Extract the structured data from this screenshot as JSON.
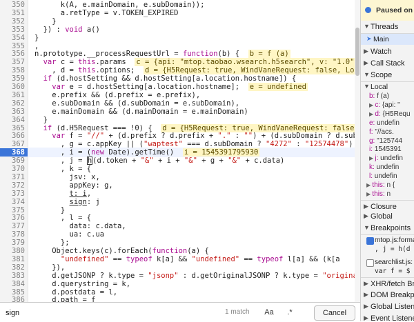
{
  "editor": {
    "lines": [
      {
        "n": "350",
        "html": "<span>k(A, e.mainDomain, e.subDomain));</span>"
      },
      {
        "n": "351",
        "html": "<span>a.retType = v.TOKEN_EXPIRED</span>"
      },
      {
        "n": "352",
        "html": "}"
      },
      {
        "n": "353",
        "html": "}) : <span class=\"kw\">void</span> a()"
      },
      {
        "n": "354",
        "html": "}"
      },
      {
        "n": "355",
        "html": ","
      },
      {
        "n": "356",
        "html": "n.prototype.__processRequestUrl = <span class=\"kw\">function</span>(b) {  <span class=\"inl\">b = f (a)</span>"
      },
      {
        "n": "357",
        "html": "<span class=\"kw\">var</span> c = <span class=\"kw\">this</span>.params  <span class=\"inl\">c = {api: \"mtop.taobao.wsearch.h5search\", v: \"1.0\", </span>"
      },
      {
        "n": "358",
        "html": "  , d = <span class=\"kw\">this</span>.options;  <span class=\"inl\">d = {H5Request: true, WindVaneRequest: false, Logi</span>"
      },
      {
        "n": "359",
        "html": "<span class=\"kw\">if</span> (d.hostSetting &amp;&amp; d.hostSetting[a.location.hostname]) {"
      },
      {
        "n": "360",
        "html": "  <span class=\"kw\">var</span> e = d.hostSetting[a.location.hostname];  <span class=\"inl\">e = undefined</span>"
      },
      {
        "n": "361",
        "html": "  e.prefix &amp;&amp; (d.prefix = e.prefix),"
      },
      {
        "n": "362",
        "html": "  e.subDomain &amp;&amp; (d.subDomain = e.subDomain),"
      },
      {
        "n": "363",
        "html": "  e.mainDomain &amp;&amp; (d.mainDomain = e.mainDomain)"
      },
      {
        "n": "364",
        "html": "}"
      },
      {
        "n": "365",
        "html": "<span class=\"kw\">if</span> (d.H5Request === !0) {  <span class=\"inl\">d = {H5Request: true, WindVaneRequest: false, </span>"
      },
      {
        "n": "366",
        "html": "  <span class=\"kw\">var</span> f = <span class=\"str\">\"//\"</span> + (d.prefix ? d.prefix + <span class=\"str\">\".\"</span> : <span class=\"str\">\"\"</span>) + (d.subDomain ? d.sub"
      },
      {
        "n": "367",
        "html": "    , g = c.appKey || (<span class=\"str\">\"waptest\"</span> === d.subDomain ? <span class=\"str\">\"4272\"</span> : <span class=\"str\">\"12574478\"</span>)"
      },
      {
        "n": "368",
        "html": "    , i = (<span class=\"kw\">new</span> Date).getTime()  <span class=\"inl\">i = 1545391795930</span>"
      },
      {
        "n": "369",
        "html": "    , j = <span class=\"cursor-box\">h</span>(d.token + <span class=\"str\">\"&amp;\"</span> + i + <span class=\"str\">\"&amp;\"</span> + g + <span class=\"str\">\"&amp;\"</span> + c.data)"
      },
      {
        "n": "370",
        "html": "    , k = {"
      },
      {
        "n": "371",
        "html": "      jsv: x,"
      },
      {
        "n": "372",
        "html": "      appKey: g,"
      },
      {
        "n": "373",
        "html": "      <u>t: i</u>,"
      },
      {
        "n": "374",
        "html": "      <u>sign</u>: j"
      },
      {
        "n": "375",
        "html": "    }"
      },
      {
        "n": "376",
        "html": "    , l = {"
      },
      {
        "n": "377",
        "html": "      data: c.data,"
      },
      {
        "n": "378",
        "html": "      ua: c.ua"
      },
      {
        "n": "379",
        "html": "    };"
      },
      {
        "n": "380",
        "html": "  Object.keys(c).forEach(<span class=\"kw\">function</span>(a) {"
      },
      {
        "n": "381",
        "html": "    <span class=\"str\">\"undefined\"</span> == <span class=\"kw\">typeof</span> k[a] &amp;&amp; <span class=\"str\">\"undefined\"</span> == <span class=\"kw\">typeof</span> l[a] &amp;&amp; (k[a"
      },
      {
        "n": "382",
        "html": "  }),"
      },
      {
        "n": "383",
        "html": "  d.getJSONP ? k.type = <span class=\"str\">\"jsonp\"</span> : d.getOriginalJSONP ? k.type = <span class=\"str\">\"origina</span>"
      },
      {
        "n": "384",
        "html": "  d.querystring = k,"
      },
      {
        "n": "385",
        "html": "  d.postdata = l,"
      },
      {
        "n": "386",
        "html": "  d.path = f"
      },
      {
        "n": "387",
        "html": "}"
      },
      {
        "n": "388",
        "html": "}"
      }
    ],
    "active_line": "368"
  },
  "search": {
    "value": "sign",
    "match_text": "1 match",
    "btn_case": "Aa",
    "btn_regex": ".*",
    "cancel_label": "Cancel"
  },
  "sidebar": {
    "paused_text": "Paused on breakpoint",
    "threads_label": "Threads",
    "main_label": "Main",
    "watch_label": "Watch",
    "callstack_label": "Call Stack",
    "scope_label": "Scope",
    "local_label": "Local",
    "locals": [
      {
        "k": "b",
        "v": " f (a)"
      },
      {
        "k": "c",
        "v": " {api: \""
      },
      {
        "k": "d",
        "v": " {H5Requ"
      },
      {
        "k": "e",
        "v": " undefin"
      },
      {
        "k": "f",
        "v": " \"//acs."
      },
      {
        "k": "g",
        "v": " \"125744"
      },
      {
        "k": "i",
        "v": " 1545391"
      },
      {
        "k": "j",
        "v": " undefin"
      },
      {
        "k": "k",
        "v": " undefin"
      },
      {
        "k": "l",
        "v": " undefin"
      },
      {
        "k": "this",
        "v": " n {"
      },
      {
        "k": "this",
        "v": " n"
      }
    ],
    "closure_label": "Closure",
    "global_label": "Global",
    "breakpoints_label": "Breakpoints",
    "bp1_file": "mtop.js:forma",
    "bp1_code": ", j = h(d",
    "bp2_file": "searchlist.js:",
    "bp2_code": "var f = $",
    "xhr_label": "XHR/fetch Brea",
    "dom_label": "DOM Breakpoi",
    "listeners_label": "Global Listene",
    "event_label": "Event Listener"
  }
}
